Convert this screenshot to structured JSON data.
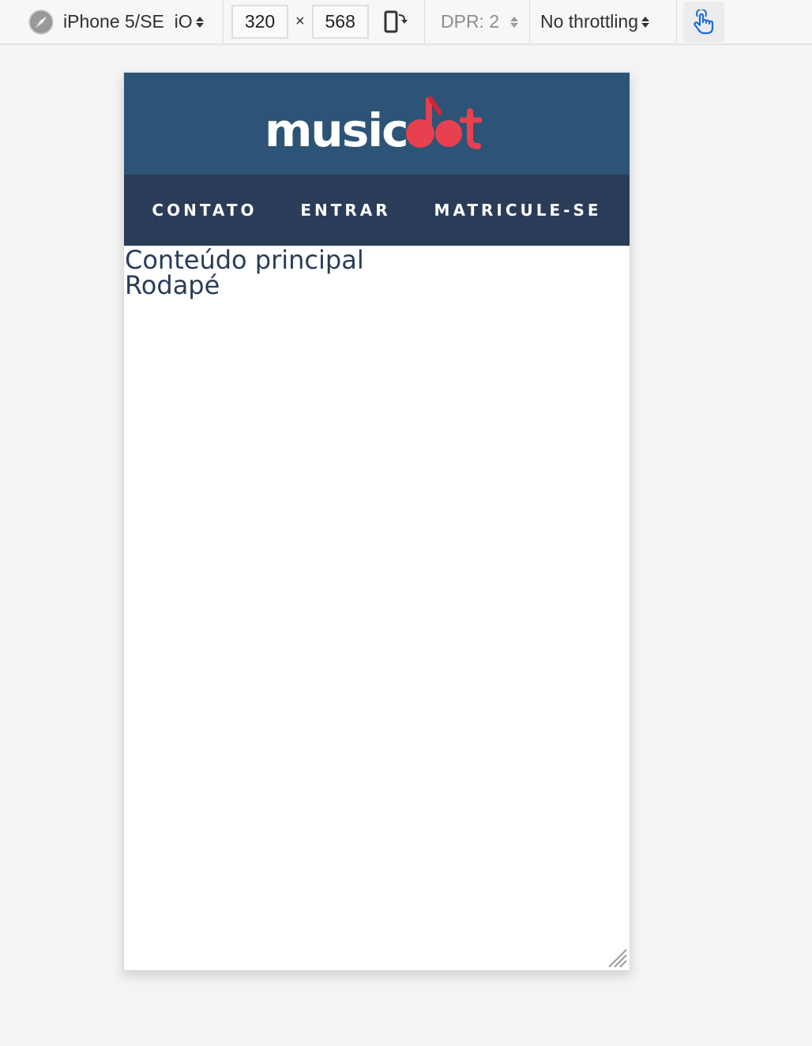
{
  "toolbar": {
    "device_icon": "safari-compass-icon",
    "device_label": "iPhone 5/SE  iO",
    "width_value": "320",
    "times_symbol": "×",
    "height_value": "568",
    "rotate_icon": "rotate-device-icon",
    "dpr_label": "DPR: 2",
    "throttle_label": "No throttling",
    "touch_icon": "touch-hand-icon",
    "colors": {
      "touch_accent": "#1a6fd8"
    }
  },
  "site": {
    "logo": {
      "text_white": "music",
      "text_red": "dot",
      "colors": {
        "white": "#ffffff",
        "red": "#e8404f",
        "header_bg": "#2d5476"
      }
    },
    "nav": {
      "items": [
        {
          "label": "CONTATO"
        },
        {
          "label": "ENTRAR"
        },
        {
          "label": "MATRICULE-SE"
        }
      ],
      "bg": "#2a3c58"
    },
    "main_text": "Conteúdo principal",
    "footer_text": "Rodapé"
  }
}
